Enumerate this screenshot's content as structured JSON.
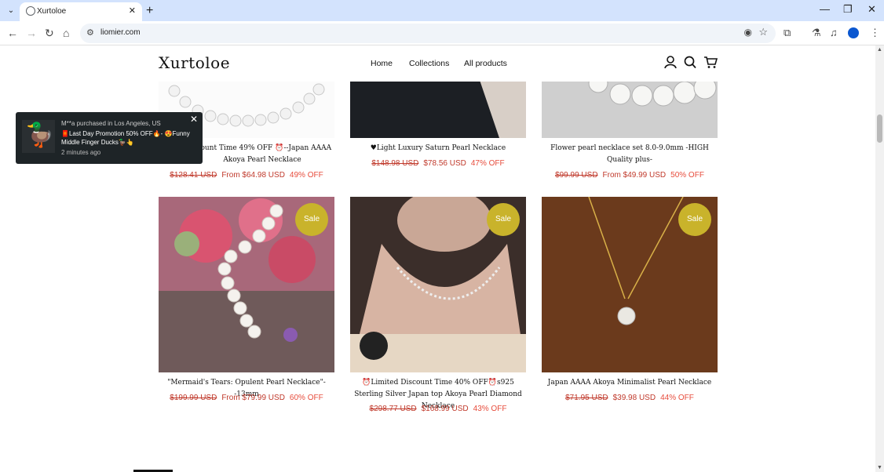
{
  "browser": {
    "tab_title": "Xurtoloe",
    "url": "liomier.com"
  },
  "site": {
    "logo": "Xurtoloe",
    "nav": [
      "Home",
      "Collections",
      "All products"
    ]
  },
  "popup": {
    "line1": "M**a purchased in Los Angeles, US",
    "line2": "🧧Last Day Promotion 50% OFF🔥- 😍Funny Middle Finger Ducks🦆👆",
    "line3": "2 minutes ago"
  },
  "row1": [
    {
      "title": "⏰Limited Discount Time 49% OFF⏰--Japan AAAA Akoya Pearl Necklace",
      "title_visible": "scount Time 49% OFF ⏰--Japan AAAA Akoya Pearl Necklace",
      "old": "$128.41 USD",
      "new": "From $64.98 USD",
      "off": "49% OFF"
    },
    {
      "title": "♥Light Luxury Saturn Pearl Necklace",
      "old": "$148.98 USD",
      "new": "$78.56 USD",
      "off": "47% OFF"
    },
    {
      "title": "Flower pearl necklace set 8.0-9.0mm -HIGH Quality plus-",
      "old": "$99.99 USD",
      "new": "From $49.99 USD",
      "off": "50% OFF"
    }
  ],
  "row2": [
    {
      "sale": "Sale",
      "title": "\"Mermaid's Tears: Opulent Pearl Necklace\"--13mm",
      "old": "$199.99 USD",
      "new": "From $79.99 USD",
      "off": "60% OFF"
    },
    {
      "sale": "Sale",
      "title": "⏰Limited Discount Time 40% OFF⏰s925 Sterling Silver Japan top Akoya Pearl Diamond Necklace",
      "old": "$298.77 USD",
      "new": "$168.99 USD",
      "off": "43% OFF"
    },
    {
      "sale": "Sale",
      "title": "Japan AAAA Akoya Minimalist Pearl Necklace",
      "old": "$71.95 USD",
      "new": "$39.98 USD",
      "off": "44% OFF"
    }
  ],
  "colors": {
    "sale_badge": "#c9b32b",
    "price_red": "#c0392b",
    "popup_bg": "#1e2427",
    "tab_bar": "#d3e3fd"
  }
}
